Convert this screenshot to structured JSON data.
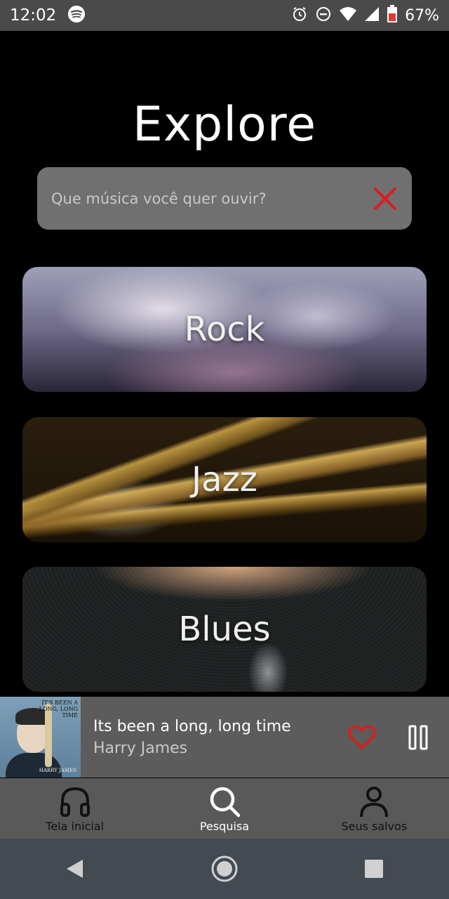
{
  "status": {
    "time": "12:02",
    "battery": "67%",
    "icons": [
      "spotify-icon",
      "alarm-icon",
      "do-not-disturb-icon",
      "wifi-icon",
      "signal-icon",
      "battery-icon"
    ]
  },
  "page": {
    "title": "Explore"
  },
  "search": {
    "placeholder": "Que música você quer ouvir?",
    "value": "",
    "clear_icon": "close-icon",
    "clear_color": "#e01b1b"
  },
  "genres": [
    {
      "label": "Rock"
    },
    {
      "label": "Jazz"
    },
    {
      "label": "Blues"
    }
  ],
  "player": {
    "album_cover_text": "IT'S BEEN A LONG, LONG TIME",
    "album_cover_artist": "HARRY JAMES",
    "title": "Its been a long, long time",
    "artist": "Harry James",
    "favorite_icon": "heart-icon",
    "favorite_color": "#e01b1b",
    "control_icon": "pause-icon"
  },
  "nav": {
    "items": [
      {
        "label": "Tela inicial",
        "icon": "headphones-icon",
        "active": false
      },
      {
        "label": "Pesquisa",
        "icon": "search-icon",
        "active": true
      },
      {
        "label": "Seus salvos",
        "icon": "user-icon",
        "active": false
      }
    ]
  },
  "system_nav": {
    "icons": [
      "back-icon",
      "home-icon",
      "recents-icon"
    ]
  }
}
